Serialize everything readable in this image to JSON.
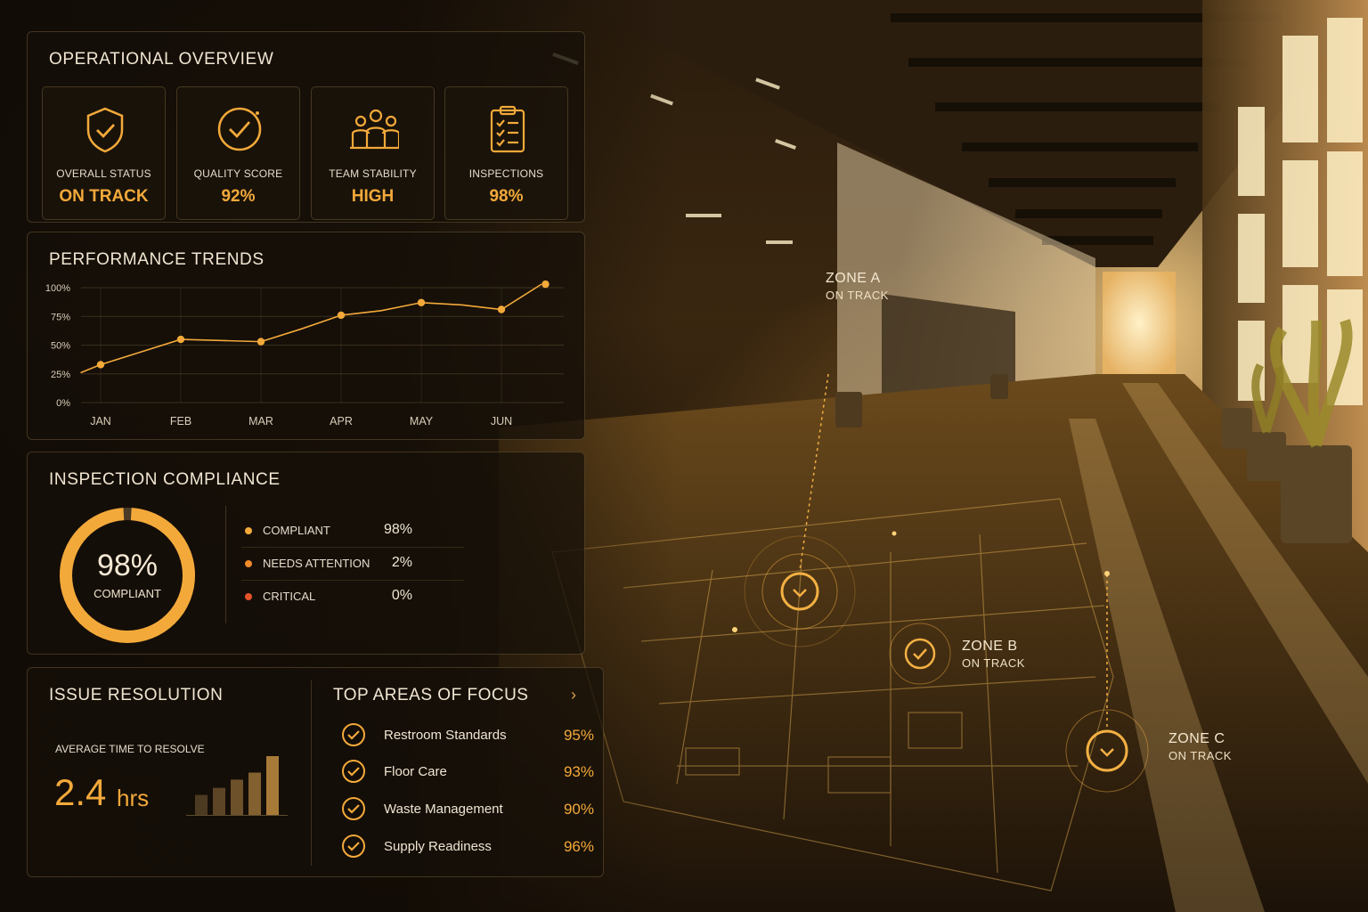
{
  "overview": {
    "title": "OPERATIONAL OVERVIEW",
    "cards": [
      {
        "label": "OVERALL STATUS",
        "value": "ON TRACK",
        "icon": "shield-check-icon"
      },
      {
        "label": "QUALITY SCORE",
        "value": "92%",
        "icon": "circle-check-icon"
      },
      {
        "label": "TEAM STABILITY",
        "value": "HIGH",
        "icon": "team-icon"
      },
      {
        "label": "INSPECTIONS",
        "value": "98%",
        "icon": "clipboard-checklist-icon"
      }
    ]
  },
  "trends": {
    "title": "PERFORMANCE TRENDS",
    "y_ticks": [
      "100%",
      "75%",
      "50%",
      "25%",
      "0%"
    ],
    "x_ticks": [
      "JAN",
      "FEB",
      "MAR",
      "APR",
      "MAY",
      "JUN"
    ]
  },
  "chart_data": {
    "type": "line",
    "title": "PERFORMANCE TRENDS",
    "categories": [
      "JAN",
      "FEB",
      "MAR",
      "APR",
      "MAY",
      "JUN"
    ],
    "x": [
      -0.25,
      0,
      0.5,
      1,
      1.5,
      2,
      2.5,
      3,
      3.5,
      4,
      4.5,
      5,
      5.5
    ],
    "y": [
      26,
      33,
      44,
      55,
      54,
      53,
      64,
      76,
      80,
      87,
      85,
      81,
      103
    ],
    "marker_x": [
      0,
      1,
      2,
      3,
      4,
      5,
      5.55
    ],
    "marker_y": [
      33,
      55,
      53,
      76,
      87,
      81,
      103
    ],
    "ylim": [
      0,
      100
    ],
    "y_tick_labels": [
      "0%",
      "25%",
      "50%",
      "75%",
      "100%"
    ],
    "grid": true,
    "color": "#f3a93a"
  },
  "compliance": {
    "title": "INSPECTION COMPLIANCE",
    "donut_value": "98%",
    "donut_label": "COMPLIANT",
    "donut_fraction": 0.98,
    "items": [
      {
        "label": "COMPLIANT",
        "value": "98%",
        "color": "#f3a93a"
      },
      {
        "label": "NEEDS ATTENTION",
        "value": "2%",
        "color": "#f08a2a"
      },
      {
        "label": "CRITICAL",
        "value": "0%",
        "color": "#e5532a"
      }
    ]
  },
  "issue": {
    "title": "ISSUE RESOLUTION",
    "avg_label": "AVERAGE TIME TO RESOLVE",
    "avg_value": "2.4",
    "avg_unit": "hrs",
    "bar_levels": [
      0.34,
      0.46,
      0.6,
      0.72,
      1.0
    ]
  },
  "focus": {
    "title": "TOP AREAS OF FOCUS",
    "chevron": "›",
    "items": [
      {
        "name": "Restroom Standards",
        "value": "95%"
      },
      {
        "name": "Floor Care",
        "value": "93%"
      },
      {
        "name": "Waste Management",
        "value": "90%"
      },
      {
        "name": "Supply Readiness",
        "value": "96%"
      }
    ]
  },
  "zones": [
    {
      "title": "ZONE A",
      "status": "ON TRACK"
    },
    {
      "title": "ZONE B",
      "status": "ON TRACK"
    },
    {
      "title": "ZONE C",
      "status": "ON TRACK"
    }
  ],
  "colors": {
    "accent": "#f3a93a",
    "text": "#f1e6d2"
  }
}
